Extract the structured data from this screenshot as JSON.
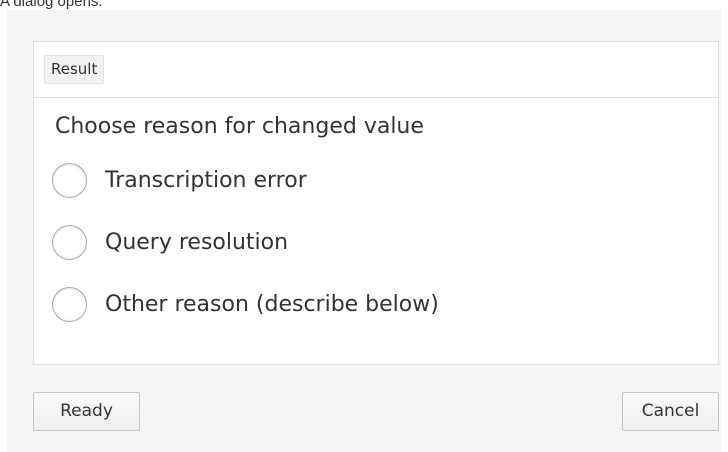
{
  "caption": "A dialog opens.",
  "dialog": {
    "header_tag": "Result",
    "prompt": "Choose reason for changed value",
    "options": [
      {
        "label": "Transcription error",
        "selected": false
      },
      {
        "label": "Query resolution",
        "selected": false
      },
      {
        "label": "Other reason (describe below)",
        "selected": false
      }
    ],
    "ready_label": "Ready",
    "cancel_label": "Cancel"
  }
}
